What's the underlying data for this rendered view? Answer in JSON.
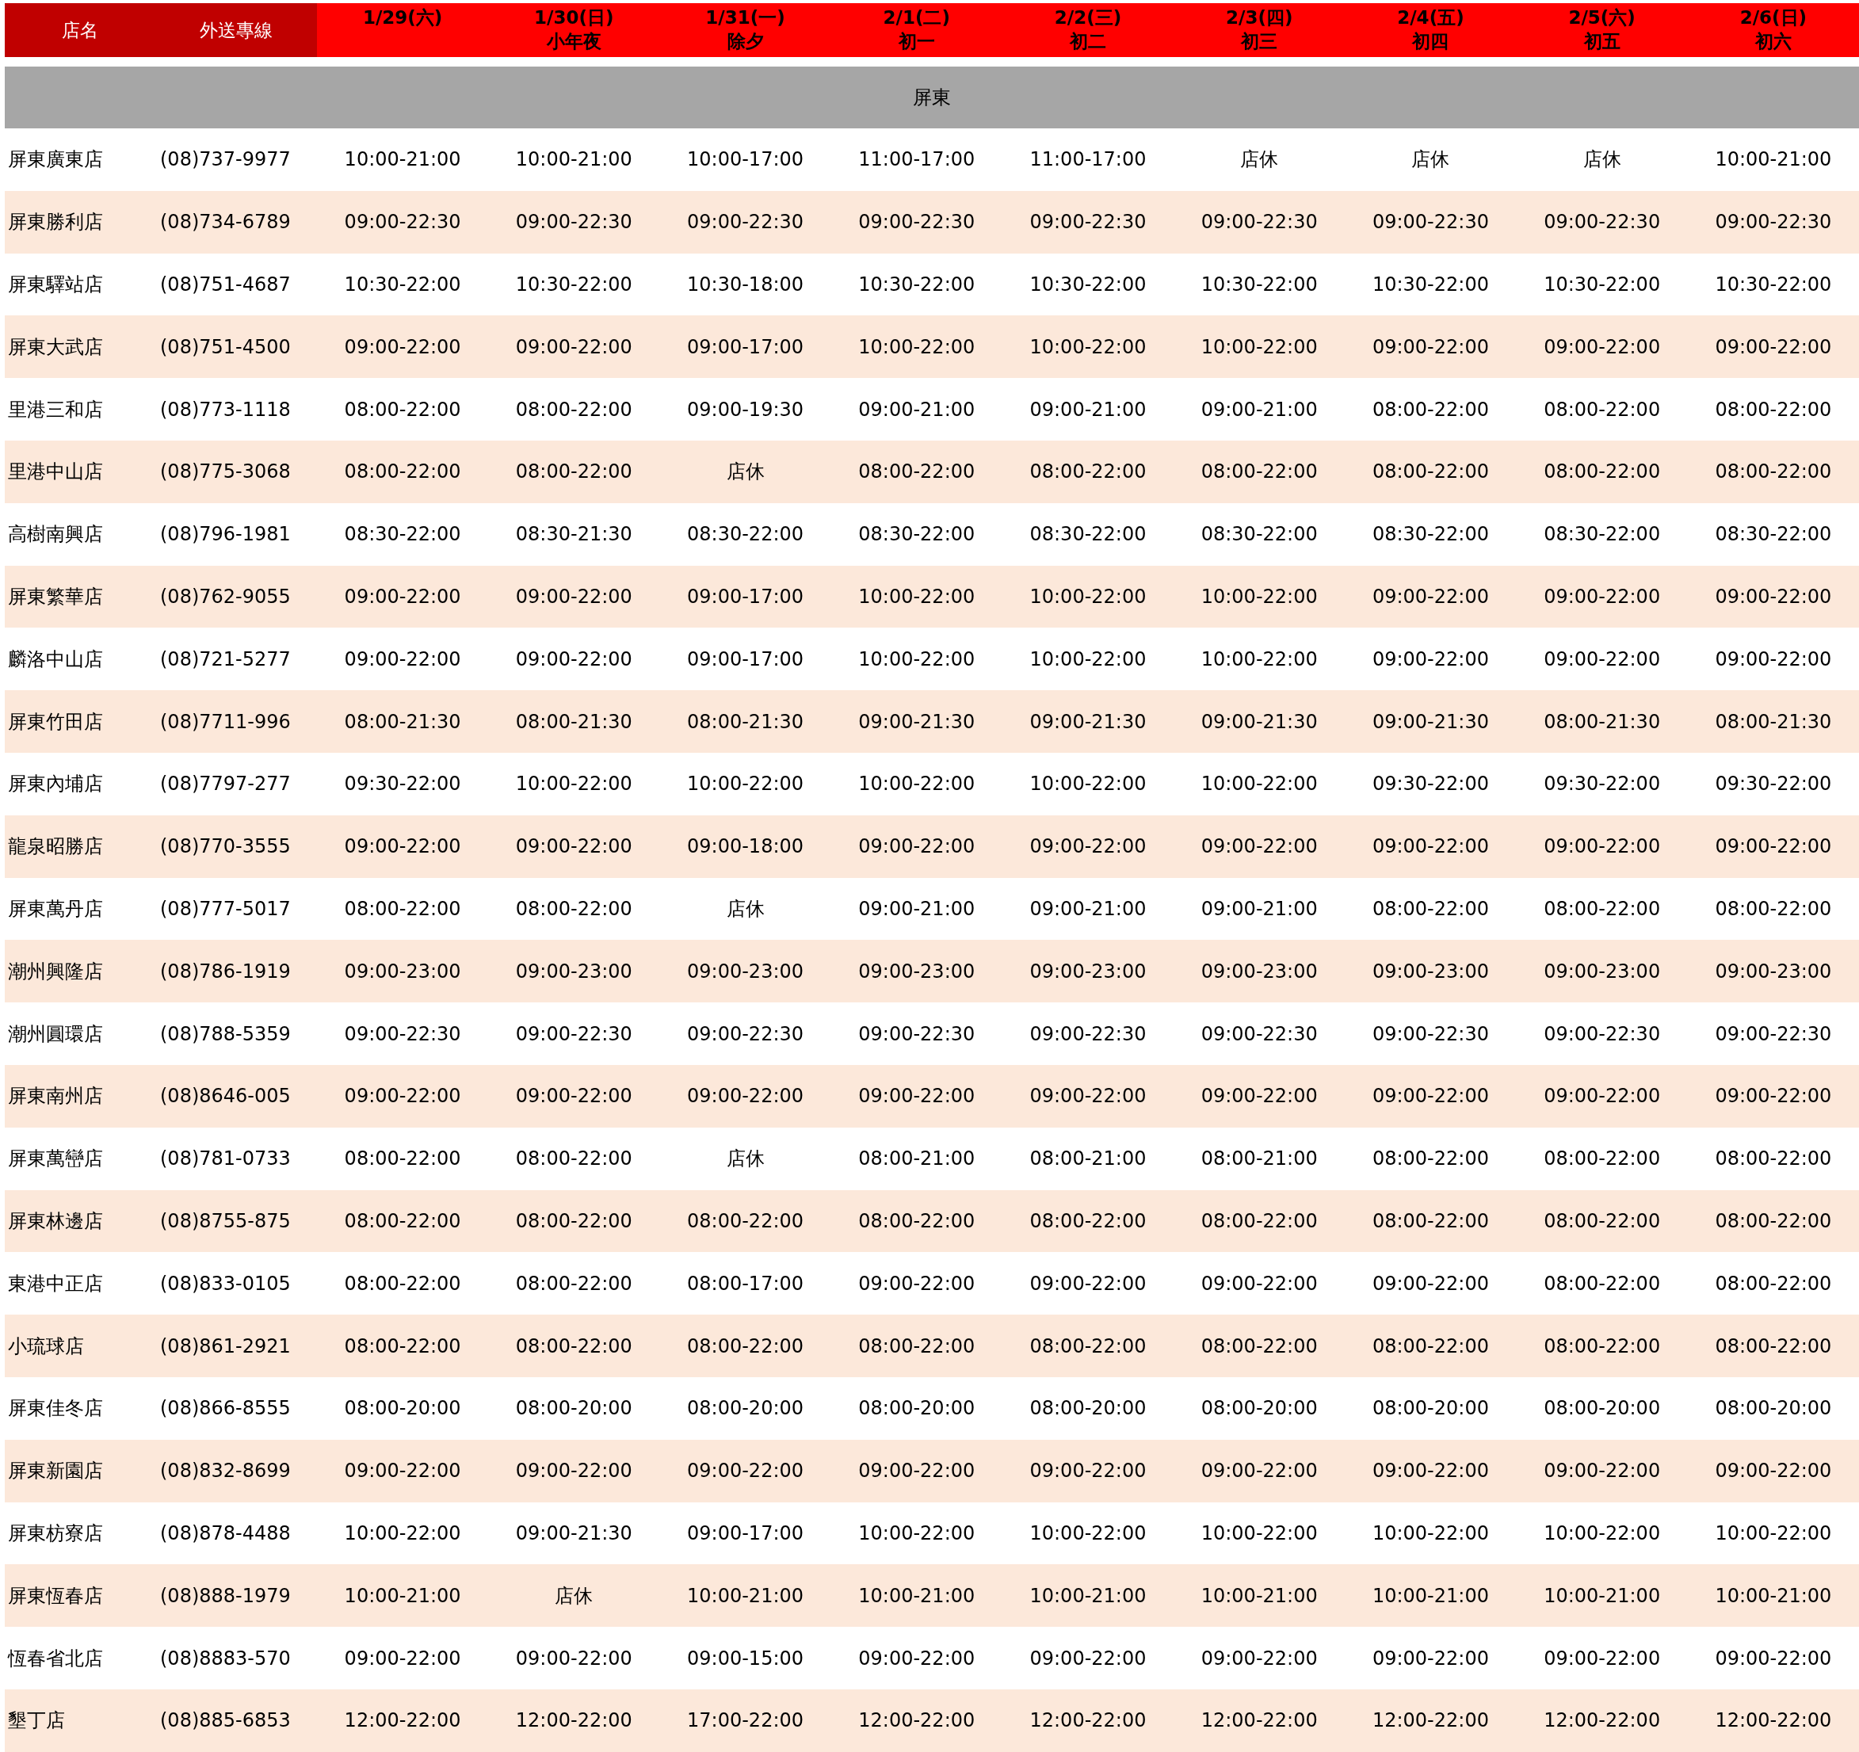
{
  "header": {
    "store_label": "店名",
    "phone_label": "外送專線",
    "days": [
      {
        "date": "1/29(六)"
      },
      {
        "date": "1/30(日)",
        "note": "小年夜"
      },
      {
        "date": "1/31(一)",
        "note": "除夕"
      },
      {
        "date": "2/1(二)",
        "note": "初一"
      },
      {
        "date": "2/2(三)",
        "note": "初二"
      },
      {
        "date": "2/3(四)",
        "note": "初三"
      },
      {
        "date": "2/4(五)",
        "note": "初四"
      },
      {
        "date": "2/5(六)",
        "note": "初五"
      },
      {
        "date": "2/6(日)",
        "note": "初六"
      }
    ]
  },
  "region": "屏東",
  "rows": [
    {
      "store": "屏東廣東店",
      "phone": "(08)737-9977",
      "hours": [
        "10:00-21:00",
        "10:00-21:00",
        "10:00-17:00",
        "11:00-17:00",
        "11:00-17:00",
        "店休",
        "店休",
        "店休",
        "10:00-21:00"
      ]
    },
    {
      "store": "屏東勝利店",
      "phone": "(08)734-6789",
      "hours": [
        "09:00-22:30",
        "09:00-22:30",
        "09:00-22:30",
        "09:00-22:30",
        "09:00-22:30",
        "09:00-22:30",
        "09:00-22:30",
        "09:00-22:30",
        "09:00-22:30"
      ]
    },
    {
      "store": "屏東驛站店",
      "phone": "(08)751-4687",
      "hours": [
        "10:30-22:00",
        "10:30-22:00",
        "10:30-18:00",
        "10:30-22:00",
        "10:30-22:00",
        "10:30-22:00",
        "10:30-22:00",
        "10:30-22:00",
        "10:30-22:00"
      ]
    },
    {
      "store": "屏東大武店",
      "phone": "(08)751-4500",
      "hours": [
        "09:00-22:00",
        "09:00-22:00",
        "09:00-17:00",
        "10:00-22:00",
        "10:00-22:00",
        "10:00-22:00",
        "09:00-22:00",
        "09:00-22:00",
        "09:00-22:00"
      ]
    },
    {
      "store": "里港三和店",
      "phone": "(08)773-1118",
      "hours": [
        "08:00-22:00",
        "08:00-22:00",
        "09:00-19:30",
        "09:00-21:00",
        "09:00-21:00",
        "09:00-21:00",
        "08:00-22:00",
        "08:00-22:00",
        "08:00-22:00"
      ]
    },
    {
      "store": "里港中山店",
      "phone": "(08)775-3068",
      "hours": [
        "08:00-22:00",
        "08:00-22:00",
        "店休",
        "08:00-22:00",
        "08:00-22:00",
        "08:00-22:00",
        "08:00-22:00",
        "08:00-22:00",
        "08:00-22:00"
      ]
    },
    {
      "store": "高樹南興店",
      "phone": "(08)796-1981",
      "hours": [
        "08:30-22:00",
        "08:30-21:30",
        "08:30-22:00",
        "08:30-22:00",
        "08:30-22:00",
        "08:30-22:00",
        "08:30-22:00",
        "08:30-22:00",
        "08:30-22:00"
      ]
    },
    {
      "store": "屏東繁華店",
      "phone": "(08)762-9055",
      "hours": [
        "09:00-22:00",
        "09:00-22:00",
        "09:00-17:00",
        "10:00-22:00",
        "10:00-22:00",
        "10:00-22:00",
        "09:00-22:00",
        "09:00-22:00",
        "09:00-22:00"
      ]
    },
    {
      "store": "麟洛中山店",
      "phone": "(08)721-5277",
      "hours": [
        "09:00-22:00",
        "09:00-22:00",
        "09:00-17:00",
        "10:00-22:00",
        "10:00-22:00",
        "10:00-22:00",
        "09:00-22:00",
        "09:00-22:00",
        "09:00-22:00"
      ]
    },
    {
      "store": "屏東竹田店",
      "phone": "(08)7711-996",
      "hours": [
        "08:00-21:30",
        "08:00-21:30",
        "08:00-21:30",
        "09:00-21:30",
        "09:00-21:30",
        "09:00-21:30",
        "09:00-21:30",
        "08:00-21:30",
        "08:00-21:30"
      ]
    },
    {
      "store": "屏東內埔店",
      "phone": "(08)7797-277",
      "hours": [
        "09:30-22:00",
        "10:00-22:00",
        "10:00-22:00",
        "10:00-22:00",
        "10:00-22:00",
        "10:00-22:00",
        "09:30-22:00",
        "09:30-22:00",
        "09:30-22:00"
      ]
    },
    {
      "store": "龍泉昭勝店",
      "phone": "(08)770-3555",
      "hours": [
        "09:00-22:00",
        "09:00-22:00",
        "09:00-18:00",
        "09:00-22:00",
        "09:00-22:00",
        "09:00-22:00",
        "09:00-22:00",
        "09:00-22:00",
        "09:00-22:00"
      ]
    },
    {
      "store": "屏東萬丹店",
      "phone": "(08)777-5017",
      "hours": [
        "08:00-22:00",
        "08:00-22:00",
        "店休",
        "09:00-21:00",
        "09:00-21:00",
        "09:00-21:00",
        "08:00-22:00",
        "08:00-22:00",
        "08:00-22:00"
      ]
    },
    {
      "store": "潮州興隆店",
      "phone": "(08)786-1919",
      "hours": [
        "09:00-23:00",
        "09:00-23:00",
        "09:00-23:00",
        "09:00-23:00",
        "09:00-23:00",
        "09:00-23:00",
        "09:00-23:00",
        "09:00-23:00",
        "09:00-23:00"
      ]
    },
    {
      "store": "潮州圓環店",
      "phone": "(08)788-5359",
      "hours": [
        "09:00-22:30",
        "09:00-22:30",
        "09:00-22:30",
        "09:00-22:30",
        "09:00-22:30",
        "09:00-22:30",
        "09:00-22:30",
        "09:00-22:30",
        "09:00-22:30"
      ]
    },
    {
      "store": "屏東南州店",
      "phone": "(08)8646-005",
      "hours": [
        "09:00-22:00",
        "09:00-22:00",
        "09:00-22:00",
        "09:00-22:00",
        "09:00-22:00",
        "09:00-22:00",
        "09:00-22:00",
        "09:00-22:00",
        "09:00-22:00"
      ]
    },
    {
      "store": "屏東萬巒店",
      "phone": "(08)781-0733",
      "hours": [
        "08:00-22:00",
        "08:00-22:00",
        "店休",
        "08:00-21:00",
        "08:00-21:00",
        "08:00-21:00",
        "08:00-22:00",
        "08:00-22:00",
        "08:00-22:00"
      ]
    },
    {
      "store": "屏東林邊店",
      "phone": "(08)8755-875",
      "hours": [
        "08:00-22:00",
        "08:00-22:00",
        "08:00-22:00",
        "08:00-22:00",
        "08:00-22:00",
        "08:00-22:00",
        "08:00-22:00",
        "08:00-22:00",
        "08:00-22:00"
      ]
    },
    {
      "store": "東港中正店",
      "phone": "(08)833-0105",
      "hours": [
        "08:00-22:00",
        "08:00-22:00",
        "08:00-17:00",
        "09:00-22:00",
        "09:00-22:00",
        "09:00-22:00",
        "09:00-22:00",
        "08:00-22:00",
        "08:00-22:00"
      ]
    },
    {
      "store": "小琉球店",
      "phone": "(08)861-2921",
      "hours": [
        "08:00-22:00",
        "08:00-22:00",
        "08:00-22:00",
        "08:00-22:00",
        "08:00-22:00",
        "08:00-22:00",
        "08:00-22:00",
        "08:00-22:00",
        "08:00-22:00"
      ]
    },
    {
      "store": "屏東佳冬店",
      "phone": "(08)866-8555",
      "hours": [
        "08:00-20:00",
        "08:00-20:00",
        "08:00-20:00",
        "08:00-20:00",
        "08:00-20:00",
        "08:00-20:00",
        "08:00-20:00",
        "08:00-20:00",
        "08:00-20:00"
      ]
    },
    {
      "store": "屏東新園店",
      "phone": "(08)832-8699",
      "hours": [
        "09:00-22:00",
        "09:00-22:00",
        "09:00-22:00",
        "09:00-22:00",
        "09:00-22:00",
        "09:00-22:00",
        "09:00-22:00",
        "09:00-22:00",
        "09:00-22:00"
      ]
    },
    {
      "store": "屏東枋寮店",
      "phone": "(08)878-4488",
      "hours": [
        "10:00-22:00",
        "09:00-21:30",
        "09:00-17:00",
        "10:00-22:00",
        "10:00-22:00",
        "10:00-22:00",
        "10:00-22:00",
        "10:00-22:00",
        "10:00-22:00"
      ]
    },
    {
      "store": "屏東恆春店",
      "phone": "(08)888-1979",
      "hours": [
        "10:00-21:00",
        "店休",
        "10:00-21:00",
        "10:00-21:00",
        "10:00-21:00",
        "10:00-21:00",
        "10:00-21:00",
        "10:00-21:00",
        "10:00-21:00"
      ]
    },
    {
      "store": "恆春省北店",
      "phone": "(08)8883-570",
      "hours": [
        "09:00-22:00",
        "09:00-22:00",
        "09:00-15:00",
        "09:00-22:00",
        "09:00-22:00",
        "09:00-22:00",
        "09:00-22:00",
        "09:00-22:00",
        "09:00-22:00"
      ]
    },
    {
      "store": "墾丁店",
      "phone": "(08)885-6853",
      "hours": [
        "12:00-22:00",
        "12:00-22:00",
        "17:00-22:00",
        "12:00-22:00",
        "12:00-22:00",
        "12:00-22:00",
        "12:00-22:00",
        "12:00-22:00",
        "12:00-22:00"
      ]
    }
  ]
}
